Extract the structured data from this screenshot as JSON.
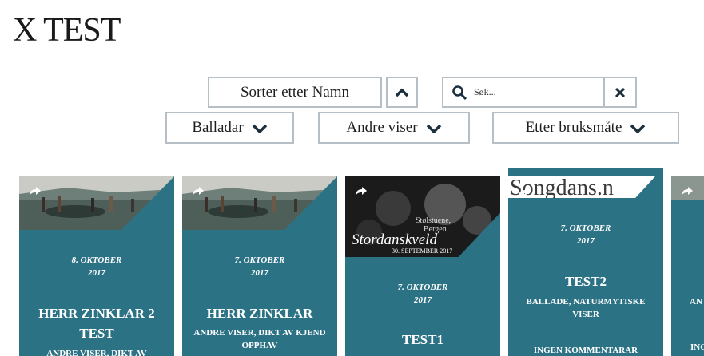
{
  "page": {
    "title": "X TEST"
  },
  "controls": {
    "sort_label": "Sorter etter Namn",
    "search_placeholder": "Søk...",
    "filters": [
      "Balladar",
      "Andre viser",
      "Etter bruksmåte"
    ]
  },
  "cards": [
    {
      "date": "8. OKTOBER",
      "year": "2017",
      "title": "HERR ZINKLAR 2 TEST",
      "categories": "ANDRE VISER, DIKT AV"
    },
    {
      "date": "7. OKTOBER",
      "year": "2017",
      "title": "HERR ZINKLAR",
      "categories": "ANDRE VISER, DIKT AV KJEND OPPHAV"
    },
    {
      "date": "7. OKTOBER",
      "year": "2017",
      "title": "TEST1",
      "image_text_1": "Stølstuene,",
      "image_text_2": "Bergen",
      "image_text_3": "Stordanskveld",
      "image_text_4": "30. SEPTEMBER 2017"
    },
    {
      "date": "7. OKTOBER",
      "year": "2017",
      "title": "TEST2",
      "categories": "BALLADE, NATURMYTISKE VISER",
      "comments": "INGEN KOMMENTARAR",
      "image_text": "Songdans.n"
    },
    {
      "partial_cat": "AN",
      "partial_comments": "ING"
    }
  ],
  "colors": {
    "card": "#2c7285",
    "border": "#b6bec6",
    "icon": "#1c2f3c"
  },
  "icons": [
    "chevron-up-icon",
    "search-icon",
    "close-icon",
    "chevron-down-icon",
    "share-icon"
  ]
}
